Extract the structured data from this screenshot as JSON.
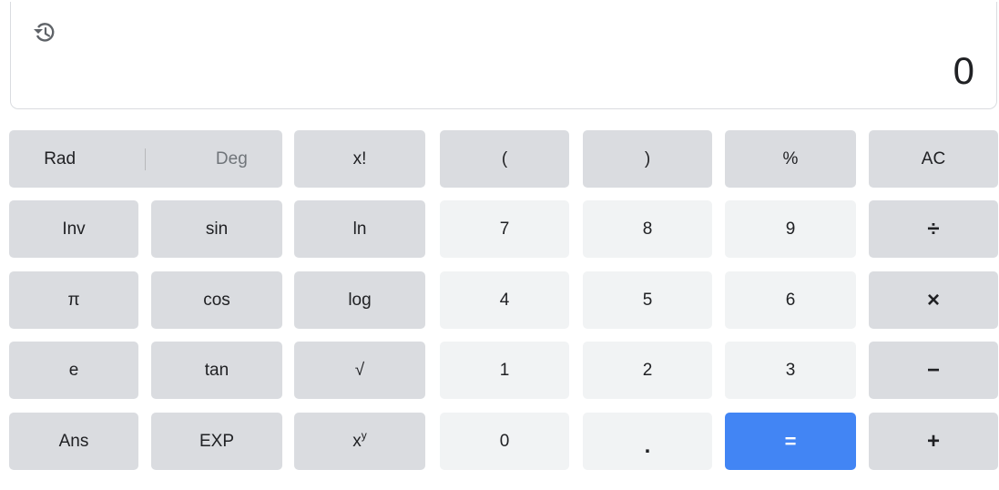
{
  "display": {
    "history_icon": "history-icon",
    "result": "0"
  },
  "keys": {
    "rad": "Rad",
    "deg": "Deg",
    "factorial": "x!",
    "open_paren": "(",
    "close_paren": ")",
    "percent": "%",
    "ac": "AC",
    "inv": "Inv",
    "sin": "sin",
    "ln": "ln",
    "seven": "7",
    "eight": "8",
    "nine": "9",
    "divide": "÷",
    "pi": "π",
    "cos": "cos",
    "log": "log",
    "four": "4",
    "five": "5",
    "six": "6",
    "multiply": "×",
    "e": "e",
    "tan": "tan",
    "sqrt": "√",
    "one": "1",
    "two": "2",
    "three": "3",
    "minus": "−",
    "ans": "Ans",
    "exp": "EXP",
    "power_base": "x",
    "power_exp": "y",
    "zero": "0",
    "decimal": ".",
    "equals": "=",
    "plus": "+"
  },
  "colors": {
    "function_key": "#dadce0",
    "number_key": "#f1f3f4",
    "equals_key": "#4285f4"
  }
}
